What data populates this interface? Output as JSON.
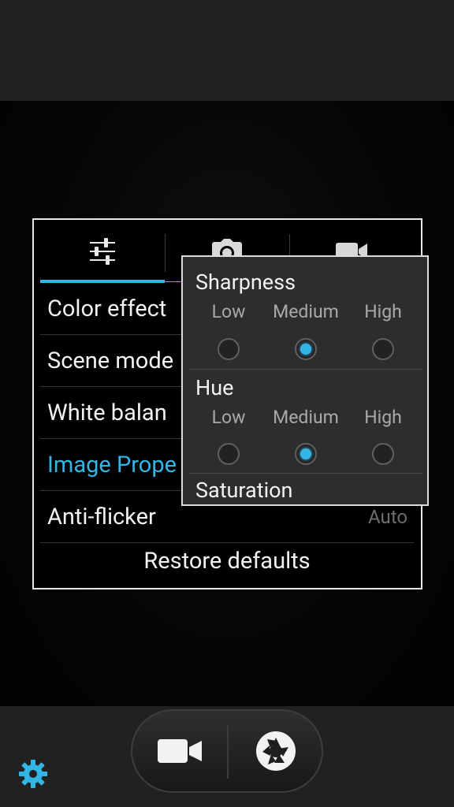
{
  "tabs": [
    {
      "name": "adjustments",
      "icon": "sliders-icon",
      "selected": true
    },
    {
      "name": "photo",
      "icon": "camera-icon",
      "selected": false
    },
    {
      "name": "video",
      "icon": "video-camera-icon",
      "selected": false
    }
  ],
  "settings": {
    "rows": [
      {
        "label": "Color effect",
        "value": ""
      },
      {
        "label": "Scene mode",
        "value": ""
      },
      {
        "label": "White balan",
        "value": ""
      },
      {
        "label": "Image Prope",
        "value": ""
      },
      {
        "label": "Anti-flicker",
        "value": "Auto"
      }
    ],
    "restore_label": "Restore defaults"
  },
  "popup": {
    "sharpness": {
      "title": "Sharpness",
      "options": [
        "Low",
        "Medium",
        "High"
      ],
      "selected_index": 1
    },
    "hue": {
      "title": "Hue",
      "options": [
        "Low",
        "Medium",
        "High"
      ],
      "selected_index": 1
    },
    "saturation": {
      "title": "Saturation"
    }
  },
  "colors": {
    "accent": "#33b5e5",
    "panel_bg": "#000000",
    "popup_bg": "#2d2d2d"
  },
  "bottom": {
    "video_icon": "video-camera-icon",
    "shutter_icon": "shutter-icon",
    "settings_icon": "gear-icon"
  }
}
